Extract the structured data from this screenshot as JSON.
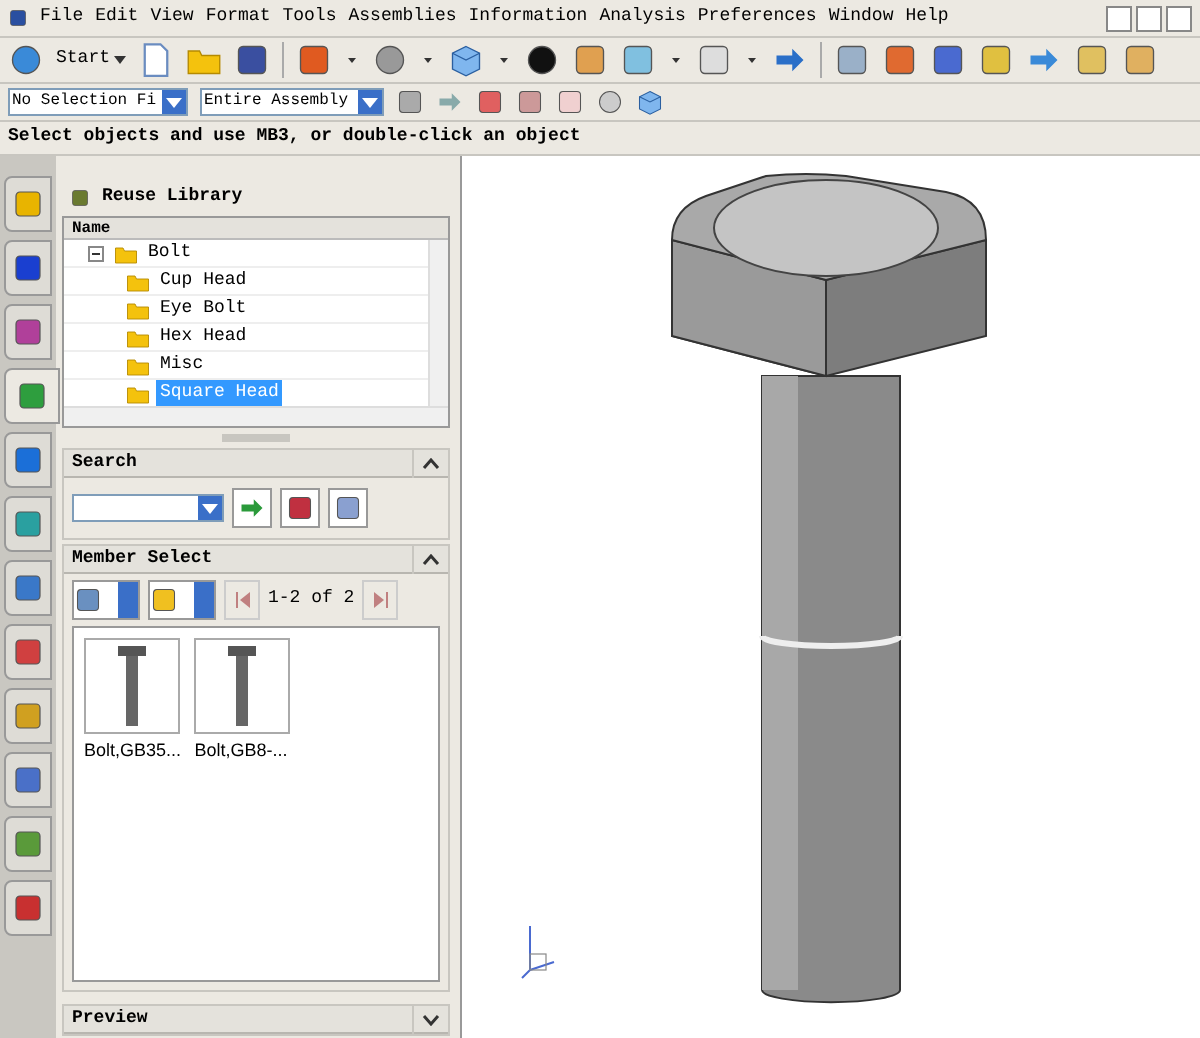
{
  "menu": [
    "File",
    "Edit",
    "View",
    "Format",
    "Tools",
    "Assemblies",
    "Information",
    "Analysis",
    "Preferences",
    "Window",
    "Help"
  ],
  "start_button": "Start",
  "selection_filter": "No Selection Fi",
  "assembly_scope": "Entire Assembly",
  "prompt": "Select objects and use MB3, or double-click an object",
  "sidebar_tabs": [
    {
      "selected": false
    },
    {
      "selected": false
    },
    {
      "selected": false
    },
    {
      "selected": true
    },
    {
      "selected": false
    },
    {
      "selected": false
    },
    {
      "selected": false
    },
    {
      "selected": false
    },
    {
      "selected": false
    },
    {
      "selected": false
    },
    {
      "selected": false
    },
    {
      "selected": false
    }
  ],
  "reuse_library": {
    "title": "Reuse Library",
    "column": "Name",
    "tree": [
      {
        "label": "Bolt",
        "expanded": true,
        "children": [
          {
            "label": "Cup Head",
            "selected": false
          },
          {
            "label": "Eye Bolt",
            "selected": false
          },
          {
            "label": "Hex Head",
            "selected": false
          },
          {
            "label": "Misc",
            "selected": false
          },
          {
            "label": "Square Head",
            "selected": true
          }
        ]
      }
    ]
  },
  "search": {
    "title": "Search"
  },
  "member_select": {
    "title": "Member Select",
    "pager": "1-2 of 2",
    "members": [
      {
        "label": "Bolt,GB35..."
      },
      {
        "label": "Bolt,GB8-..."
      }
    ]
  },
  "preview": {
    "title": "Preview"
  }
}
